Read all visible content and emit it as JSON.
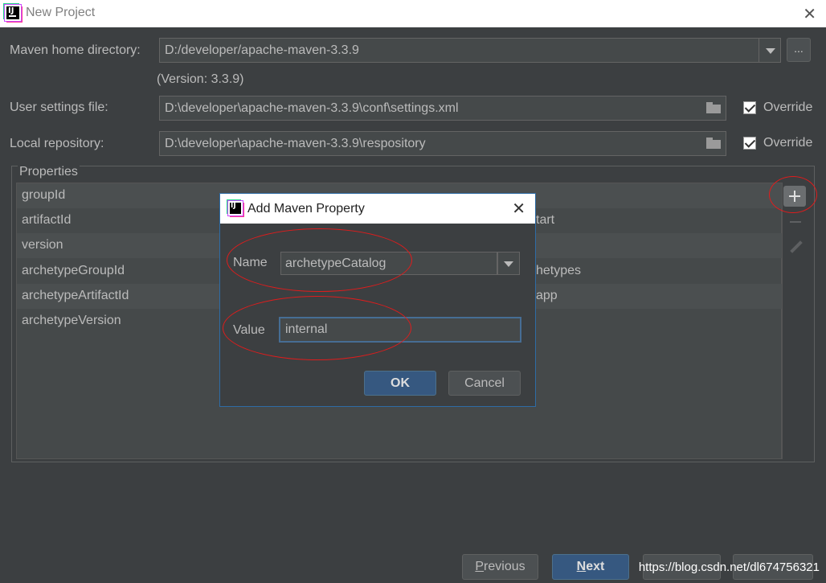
{
  "window": {
    "title": "New Project",
    "close_icon": "close-icon"
  },
  "maven": {
    "home_label": "Maven home directory:",
    "home_value": "D:/developer/apache-maven-3.3.9",
    "version_text": "(Version: 3.3.9)",
    "browse_label": "...",
    "settings_label": "User settings file:",
    "settings_value": "D:\\developer\\apache-maven-3.3.9\\conf\\settings.xml",
    "settings_override": "Override",
    "repo_label": "Local repository:",
    "repo_value": "D:\\developer\\apache-maven-3.3.9\\respository",
    "repo_override": "Override"
  },
  "properties": {
    "title": "Properties",
    "rows": [
      {
        "key": "groupId",
        "value": ""
      },
      {
        "key": "artifactId",
        "value": "tart"
      },
      {
        "key": "version",
        "value": ""
      },
      {
        "key": "archetypeGroupId",
        "value": "hetypes"
      },
      {
        "key": "archetypeArtifactId",
        "value": "app"
      },
      {
        "key": "archetypeVersion",
        "value": ""
      }
    ]
  },
  "dialog": {
    "title": "Add Maven Property",
    "name_label": "Name",
    "name_value": "archetypeCatalog",
    "value_label": "Value",
    "value_value": "internal",
    "ok_label": "OK",
    "cancel_label": "Cancel"
  },
  "footer": {
    "previous_mnemonic": "P",
    "previous_rest": "revious",
    "next_mnemonic": "N",
    "next_rest": "ext",
    "watermark": "https://blog.csdn.net/dl674756321"
  },
  "colors": {
    "accent": "#365880",
    "annotation": "#e01c1c",
    "background": "#3c3f41"
  }
}
